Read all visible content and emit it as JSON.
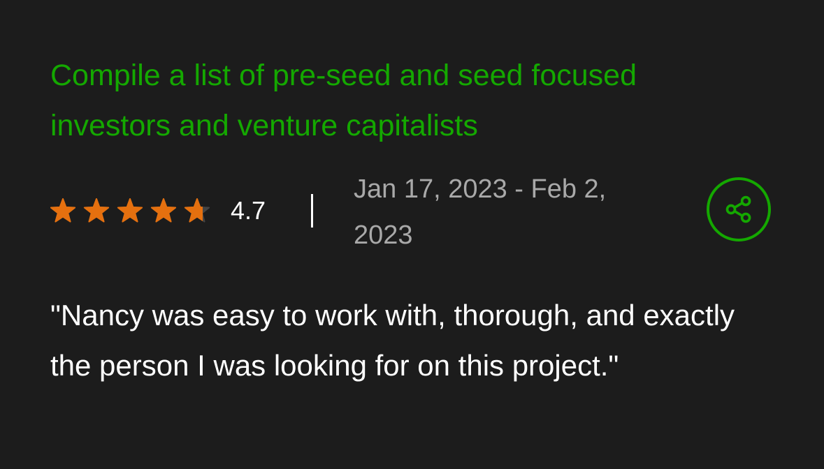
{
  "review": {
    "title": "Compile a list of pre-seed and seed focused investors and venture capitalists",
    "rating": 4.7,
    "rating_label": "4.7",
    "date_range": "Jan 17, 2023 - Feb 2, 2023",
    "quote": "\"Nancy was easy to work with, thorough, and exactly the person I was looking for on this project.\""
  },
  "icons": {
    "star": "star-icon",
    "share": "share-icon"
  },
  "colors": {
    "background": "#1c1c1c",
    "title": "#14a800",
    "star_filled": "#e5700f",
    "star_empty": "#444444",
    "date_text": "#a9a9a9",
    "body_text": "#ffffff",
    "share_accent": "#14a800"
  }
}
